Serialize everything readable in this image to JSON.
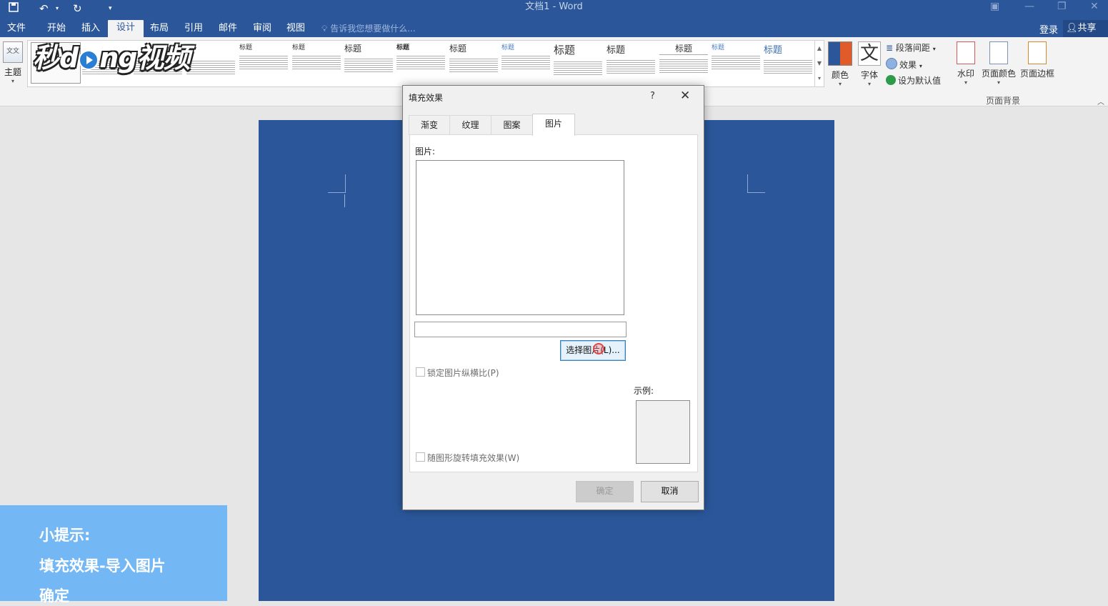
{
  "titlebar": {
    "document_title": "文档1 - Word",
    "qat": [
      "save-icon",
      "undo-icon",
      "redo-icon",
      "customize-icon"
    ]
  },
  "tabs": [
    "文件",
    "开始",
    "插入",
    "设计",
    "布局",
    "引用",
    "邮件",
    "审阅",
    "视图"
  ],
  "active_tab": "设计",
  "tell_me": "告诉我您想要做什么...",
  "account": {
    "login": "登录",
    "share": "共享"
  },
  "ribbon": {
    "theme_label": "主题",
    "theme_thumb": "文文",
    "style_gallery": [
      {
        "heading": "标题"
      },
      {
        "heading": "标题"
      },
      {
        "heading": "标题"
      },
      {
        "heading": "标题"
      },
      {
        "heading": "标题"
      },
      {
        "heading": "标题"
      },
      {
        "heading": "标题"
      },
      {
        "heading": "标题"
      },
      {
        "heading": "标题"
      },
      {
        "heading": "标题"
      },
      {
        "heading": "标题"
      }
    ],
    "colors_label": "颜色",
    "fonts_label": "字体",
    "fonts_glyph": "文",
    "paragraph_spacing": "段落间距",
    "effects": "效果",
    "set_default": "设为默认值",
    "watermark": "水印",
    "page_color": "页面颜色",
    "page_borders": "页面边框",
    "page_background_group": "页面背景"
  },
  "watermark_logo": {
    "part1": "秒d",
    "part2": "ng视频"
  },
  "dialog": {
    "title": "填充效果",
    "help": "?",
    "close": "✕",
    "tabs": [
      "渐变",
      "纹理",
      "图案",
      "图片"
    ],
    "active_tab": "图片",
    "picture_label": "图片:",
    "path_value": "",
    "select_button": "选择图片(L)...",
    "lock_aspect": "锁定图片纵横比(P)",
    "rotate_with_shape": "随图形旋转填充效果(W)",
    "sample_label": "示例:",
    "ok": "确定",
    "cancel": "取消"
  },
  "tip": {
    "line1": "小提示:",
    "line2": "填充效果-导入图片",
    "line3": "确定"
  },
  "colors": {
    "word_blue": "#2b579a",
    "tip_blue": "#73b7f5",
    "ribbon_bg": "#f3f3f3"
  }
}
